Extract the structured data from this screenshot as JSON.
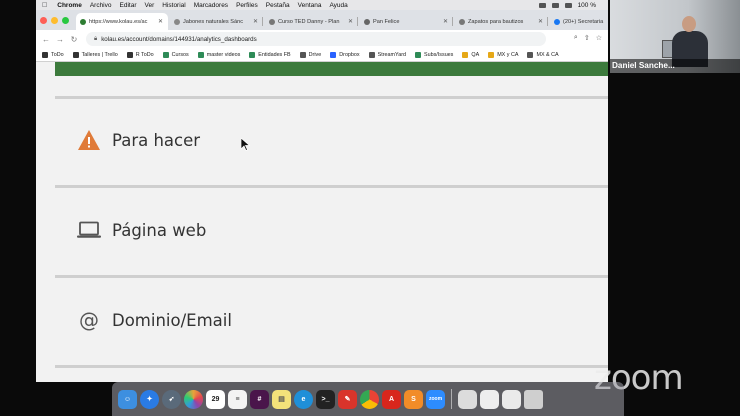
{
  "menubar": {
    "app": "Chrome",
    "items": [
      "Archivo",
      "Editar",
      "Ver",
      "Historial",
      "Marcadores",
      "Perfiles",
      "Pestaña",
      "Ventana",
      "Ayuda"
    ],
    "status": "100 %"
  },
  "tabs": [
    {
      "title": "https://www.kolau.es/ac",
      "active": true,
      "color": "#2e7d32"
    },
    {
      "title": "Jabones naturales Sánc",
      "active": false,
      "color": "#888888"
    },
    {
      "title": "Curso TED Danny - Plan",
      "active": false,
      "color": "#777777"
    },
    {
      "title": "Pan Felice",
      "active": false,
      "color": "#666666"
    },
    {
      "title": "Zapatos para bautizos",
      "active": false,
      "color": "#777777"
    },
    {
      "title": "(20+) Secretaria",
      "active": false,
      "color": "#1877f2"
    }
  ],
  "address_bar": {
    "url": "kolau.es/account/domains/144931/analytics_dashboards"
  },
  "bookmarks": [
    {
      "label": "ToDo",
      "color": "#333333"
    },
    {
      "label": "Talleres | Trello",
      "color": "#333333"
    },
    {
      "label": "R ToDo",
      "color": "#333333"
    },
    {
      "label": "Cursos",
      "color": "#2e8b57"
    },
    {
      "label": "master videos",
      "color": "#2e8b57"
    },
    {
      "label": "Entidades FB",
      "color": "#2e8b57"
    },
    {
      "label": "Drive",
      "color": "#555555"
    },
    {
      "label": "Dropbox",
      "color": "#2962ff"
    },
    {
      "label": "StreamYard",
      "color": "#555555"
    },
    {
      "label": "Subs/Issues",
      "color": "#2e8b57"
    },
    {
      "label": "QA",
      "color": "#e6a817"
    },
    {
      "label": "MX y CA",
      "color": "#e6a817"
    },
    {
      "label": "MX & CA",
      "color": "#555555"
    }
  ],
  "page": {
    "accent_green": "#3c7a3c",
    "sections": [
      {
        "label": "Para hacer",
        "icon": "warning-icon",
        "icon_color": "#e07b39"
      },
      {
        "label": "Página web",
        "icon": "laptop-icon",
        "icon_color": "#555555"
      },
      {
        "label": "Dominio/Email",
        "icon": "at-sign-icon",
        "icon_glyph": "@",
        "icon_color": "#555555"
      }
    ]
  },
  "webcam": {
    "participant_name": "Daniel Sanche..."
  },
  "zoom_watermark": "zoom",
  "dock": {
    "apps": [
      {
        "name": "finder-icon",
        "color": "#3d8fe0"
      },
      {
        "name": "safari-icon",
        "color": "#2a7be4"
      },
      {
        "name": "launchpad-icon",
        "color": "#5a6a7a"
      },
      {
        "name": "photos-icon",
        "color": "#e8a33a"
      },
      {
        "name": "calendar-icon",
        "label": "29",
        "color": "#ffffff"
      },
      {
        "name": "notes-icon",
        "color": "#f3f3f3"
      },
      {
        "name": "slack-icon",
        "color": "#4a154b"
      },
      {
        "name": "stickies-icon",
        "color": "#f3e27a"
      },
      {
        "name": "edge-icon",
        "color": "#1f8fd8"
      },
      {
        "name": "terminal-icon",
        "color": "#222222"
      },
      {
        "name": "sublime-red-icon",
        "color": "#d9342b"
      },
      {
        "name": "chrome-icon",
        "color": "#4285f4"
      },
      {
        "name": "acrobat-icon",
        "color": "#d8261c"
      },
      {
        "name": "sublime-text-icon",
        "color": "#f28c28"
      },
      {
        "name": "zoom-app-icon",
        "label": "zoom",
        "color": "#2d8cff"
      },
      {
        "name": "preview-icon",
        "color": "#dcdcdc"
      },
      {
        "name": "keynote-icon",
        "color": "#eeeeee"
      },
      {
        "name": "document-icon",
        "color": "#eaeaea"
      },
      {
        "name": "trash-icon",
        "color": "#cfcfcf"
      }
    ]
  }
}
